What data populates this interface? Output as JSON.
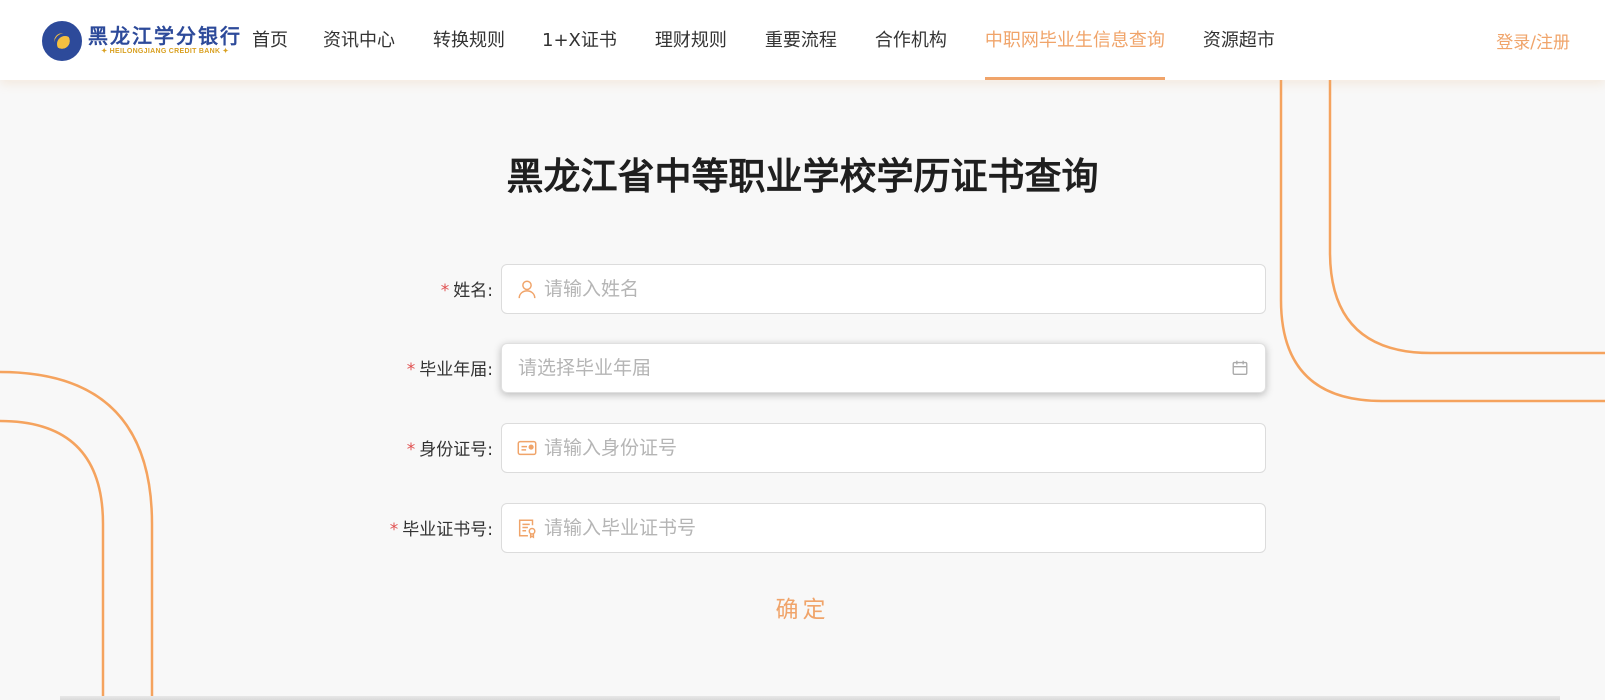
{
  "logo": {
    "cn": "黑龙江学分银行",
    "en": "✦ HEILONGJIANG CREDIT BANK ✦"
  },
  "nav": [
    {
      "label": "首页"
    },
    {
      "label": "资讯中心"
    },
    {
      "label": "转换规则"
    },
    {
      "label": "1+X证书"
    },
    {
      "label": "理财规则"
    },
    {
      "label": "重要流程"
    },
    {
      "label": "合作机构"
    },
    {
      "label": "中职网毕业生信息查询",
      "active": true
    },
    {
      "label": "资源超市"
    }
  ],
  "login": "登录/注册",
  "page": {
    "title": "黑龙江省中等职业学校学历证书查询"
  },
  "form": {
    "required_mark": "*",
    "name": {
      "label": "姓名:",
      "placeholder": "请输入姓名",
      "icon": "user-icon"
    },
    "year": {
      "label": "毕业年届:",
      "placeholder": "请选择毕业年届",
      "icon": "calendar-icon"
    },
    "id": {
      "label": "身份证号:",
      "placeholder": "请输入身份证号",
      "icon": "id-card-icon"
    },
    "cert": {
      "label": "毕业证书号:",
      "placeholder": "请输入毕业证书号",
      "icon": "certificate-icon"
    },
    "submit": "确定"
  },
  "colors": {
    "accent": "#f0a46a",
    "brand": "#2d4a9a",
    "required": "#e05050"
  }
}
